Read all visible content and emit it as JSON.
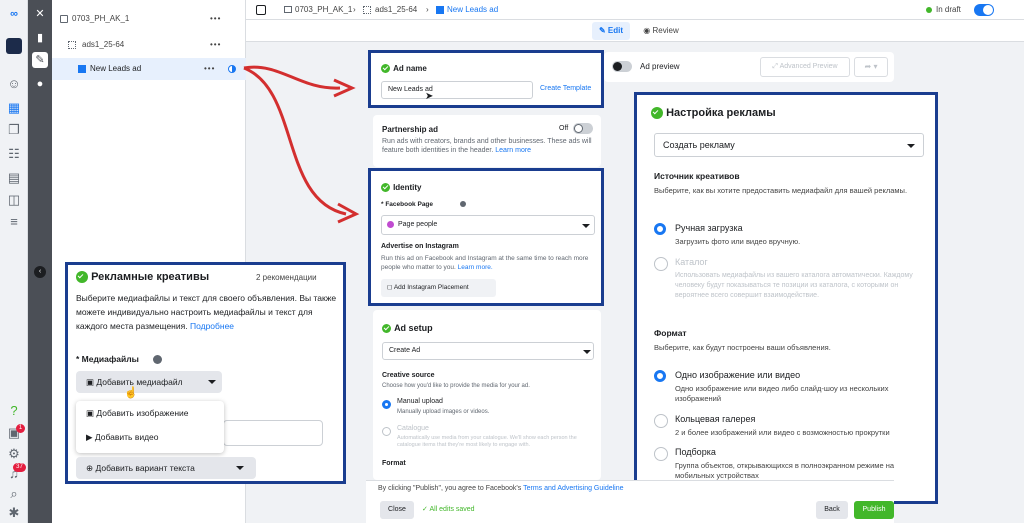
{
  "tree": {
    "campaign": "0703_PH_AK_1",
    "adset": "ads1_25-64",
    "ad": "New Leads ad"
  },
  "breadcrumb": {
    "campaign": "0703_PH_AK_1",
    "adset": "ads1_25-64",
    "ad": "New Leads ad"
  },
  "header": {
    "status": "In draft"
  },
  "tabs": {
    "edit": "Edit",
    "review": "Review"
  },
  "preview": {
    "label": "Ad preview",
    "advanced": "Advanced Preview"
  },
  "ad_name": {
    "title": "Ad name",
    "value": "New Leads ad",
    "create_template": "Create Template"
  },
  "partnership": {
    "title": "Partnership ad",
    "toggle": "Off",
    "desc": "Run ads with creators, brands and other businesses. These ads will feature both identities in the header.",
    "learn": "Learn more"
  },
  "identity": {
    "title": "Identity",
    "fb_label": "* Facebook Page",
    "page": "Page people",
    "ig_title": "Advertise on Instagram",
    "ig_desc": "Run this ad on Facebook and Instagram at the same time to reach more people who matter to you.",
    "learn": "Learn more.",
    "ig_button": "Add Instagram Placement"
  },
  "ad_setup": {
    "title": "Ad setup",
    "select": "Create Ad",
    "source_title": "Creative source",
    "source_desc": "Choose how you'd like to provide the media for your ad.",
    "manual": "Manual upload",
    "manual_desc": "Manually upload images or videos.",
    "catalogue": "Catalogue",
    "catalogue_desc": "Automatically use media from your catalogue. We'll show each person the catalogue items that they're most likely to engage with.",
    "format": "Format"
  },
  "ru_setup": {
    "title": "Настройка рекламы",
    "select": "Создать рекламу",
    "source_title": "Источник креативов",
    "source_desc": "Выберите, как вы хотите предоставить медиафайл для вашей рекламы.",
    "manual": "Ручная загрузка",
    "manual_desc": "Загрузить фото или видео вручную.",
    "catalog": "Каталог",
    "catalog_desc": "Использовать медиафайлы из вашего каталога автоматически. Каждому человеку будут показываться те позиции из каталога, с которыми он вероятнее всего совершит взаимодействие.",
    "format_title": "Формат",
    "format_desc": "Выберите, как будут построены ваши объявления.",
    "opt1": "Одно изображение или видео",
    "opt1_desc": "Одно изображение или видео либо слайд-шоу из нескольких изображений",
    "opt2": "Кольцевая галерея",
    "opt2_desc": "2 и более изображений или видео с возможностью прокрутки",
    "opt3": "Подборка",
    "opt3_desc": "Группа объектов, открывающихся в полноэкранном режиме на мобильных устройствах"
  },
  "ru_creative": {
    "title": "Рекламные креативы",
    "count": "2 рекомендации",
    "desc": "Выберите медиафайлы и текст для своего объявления. Вы также можете индивидуально настроить медиафайлы и текст для каждого места размещения.",
    "more": "Подробнее",
    "media_label": "* Медиафайлы",
    "add_media": "Добавить медиафайл",
    "add_image": "Добавить изображение",
    "add_video": "Добавить видео",
    "add_text": "Добавить вариант текста"
  },
  "footer": {
    "consent": "By clicking \"Publish\", you agree to Facebook's",
    "terms": "Terms and Advertising Guideline",
    "close": "Close",
    "saved": "All edits saved",
    "back": "Back",
    "publish": "Publish"
  },
  "badges": {
    "help": "1",
    "notif": "37"
  },
  "colors": {
    "blue": "#1877f2",
    "green": "#42b72a",
    "frame": "#1a3d8f",
    "arrow": "#d32f2f"
  }
}
